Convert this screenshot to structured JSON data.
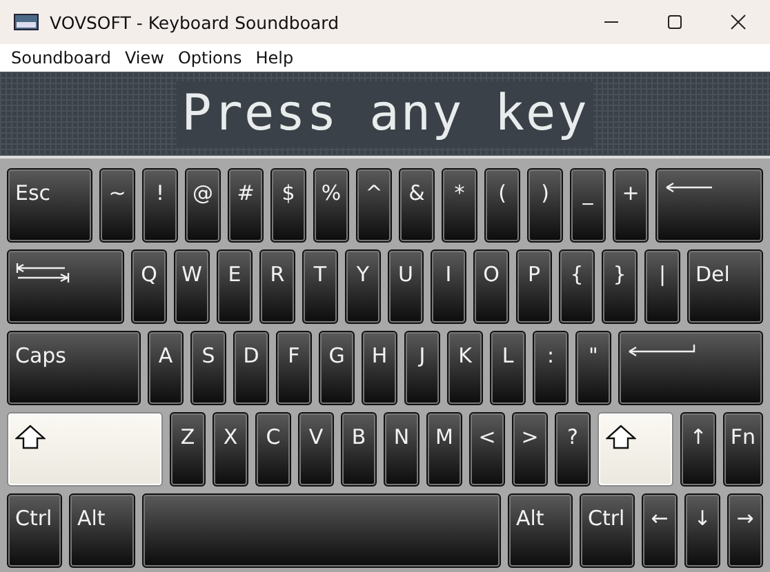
{
  "window": {
    "title": "VOVSOFT - Keyboard Soundboard"
  },
  "menu": [
    {
      "label": "Soundboard"
    },
    {
      "label": "View"
    },
    {
      "label": "Options"
    },
    {
      "label": "Help"
    }
  ],
  "display": {
    "text": "Press any key"
  },
  "keyboard": {
    "rows": [
      {
        "keys": [
          {
            "kind": "text",
            "label": "Esc",
            "pressed": false
          },
          {
            "kind": "text",
            "label": "~",
            "pressed": false
          },
          {
            "kind": "text",
            "label": "!",
            "pressed": false
          },
          {
            "kind": "text",
            "label": "@",
            "pressed": false
          },
          {
            "kind": "text",
            "label": "#",
            "pressed": false
          },
          {
            "kind": "text",
            "label": "$",
            "pressed": false
          },
          {
            "kind": "text",
            "label": "%",
            "pressed": false
          },
          {
            "kind": "text",
            "label": "^",
            "pressed": false
          },
          {
            "kind": "text",
            "label": "&",
            "pressed": false
          },
          {
            "kind": "text",
            "label": "*",
            "pressed": false
          },
          {
            "kind": "text",
            "label": "(",
            "pressed": false
          },
          {
            "kind": "text",
            "label": ")",
            "pressed": false
          },
          {
            "kind": "text",
            "label": "_",
            "pressed": false
          },
          {
            "kind": "text",
            "label": "+",
            "pressed": false
          },
          {
            "kind": "backspace",
            "pressed": false
          }
        ]
      },
      {
        "keys": [
          {
            "kind": "tab",
            "pressed": false
          },
          {
            "kind": "text",
            "label": "Q",
            "pressed": false
          },
          {
            "kind": "text",
            "label": "W",
            "pressed": false
          },
          {
            "kind": "text",
            "label": "E",
            "pressed": false
          },
          {
            "kind": "text",
            "label": "R",
            "pressed": false
          },
          {
            "kind": "text",
            "label": "T",
            "pressed": false
          },
          {
            "kind": "text",
            "label": "Y",
            "pressed": false
          },
          {
            "kind": "text",
            "label": "U",
            "pressed": false
          },
          {
            "kind": "text",
            "label": "I",
            "pressed": false
          },
          {
            "kind": "text",
            "label": "O",
            "pressed": false
          },
          {
            "kind": "text",
            "label": "P",
            "pressed": false
          },
          {
            "kind": "text",
            "label": "{",
            "pressed": false
          },
          {
            "kind": "text",
            "label": "}",
            "pressed": false
          },
          {
            "kind": "text",
            "label": "|",
            "pressed": false
          },
          {
            "kind": "text",
            "label": "Del",
            "pressed": false
          }
        ]
      },
      {
        "keys": [
          {
            "kind": "text",
            "label": "Caps",
            "pressed": false
          },
          {
            "kind": "text",
            "label": "A",
            "pressed": false
          },
          {
            "kind": "text",
            "label": "S",
            "pressed": false
          },
          {
            "kind": "text",
            "label": "D",
            "pressed": false
          },
          {
            "kind": "text",
            "label": "F",
            "pressed": false
          },
          {
            "kind": "text",
            "label": "G",
            "pressed": false
          },
          {
            "kind": "text",
            "label": "H",
            "pressed": false
          },
          {
            "kind": "text",
            "label": "J",
            "pressed": false
          },
          {
            "kind": "text",
            "label": "K",
            "pressed": false
          },
          {
            "kind": "text",
            "label": "L",
            "pressed": false
          },
          {
            "kind": "text",
            "label": ":",
            "pressed": false
          },
          {
            "kind": "text",
            "label": "\"",
            "pressed": false
          },
          {
            "kind": "enter",
            "pressed": false
          }
        ]
      },
      {
        "keys": [
          {
            "kind": "shift",
            "pressed": true
          },
          {
            "kind": "text",
            "label": "Z",
            "pressed": false
          },
          {
            "kind": "text",
            "label": "X",
            "pressed": false
          },
          {
            "kind": "text",
            "label": "C",
            "pressed": false
          },
          {
            "kind": "text",
            "label": "V",
            "pressed": false
          },
          {
            "kind": "text",
            "label": "B",
            "pressed": false
          },
          {
            "kind": "text",
            "label": "N",
            "pressed": false
          },
          {
            "kind": "text",
            "label": "M",
            "pressed": false
          },
          {
            "kind": "text",
            "label": "<",
            "pressed": false
          },
          {
            "kind": "text",
            "label": ">",
            "pressed": false
          },
          {
            "kind": "text",
            "label": "?",
            "pressed": false
          },
          {
            "kind": "shift",
            "pressed": true
          },
          {
            "kind": "text",
            "label": "↑",
            "pressed": false
          },
          {
            "kind": "text",
            "label": "Fn",
            "pressed": false
          }
        ]
      },
      {
        "keys": [
          {
            "kind": "text",
            "label": "Ctrl",
            "pressed": false
          },
          {
            "kind": "text",
            "label": "Alt",
            "pressed": false
          },
          {
            "kind": "space",
            "pressed": false
          },
          {
            "kind": "text",
            "label": "Alt",
            "pressed": false
          },
          {
            "kind": "text",
            "label": "Ctrl",
            "pressed": false
          },
          {
            "kind": "text",
            "label": "←",
            "pressed": false
          },
          {
            "kind": "text",
            "label": "↓",
            "pressed": false
          },
          {
            "kind": "text",
            "label": "→",
            "pressed": false
          }
        ]
      }
    ]
  }
}
